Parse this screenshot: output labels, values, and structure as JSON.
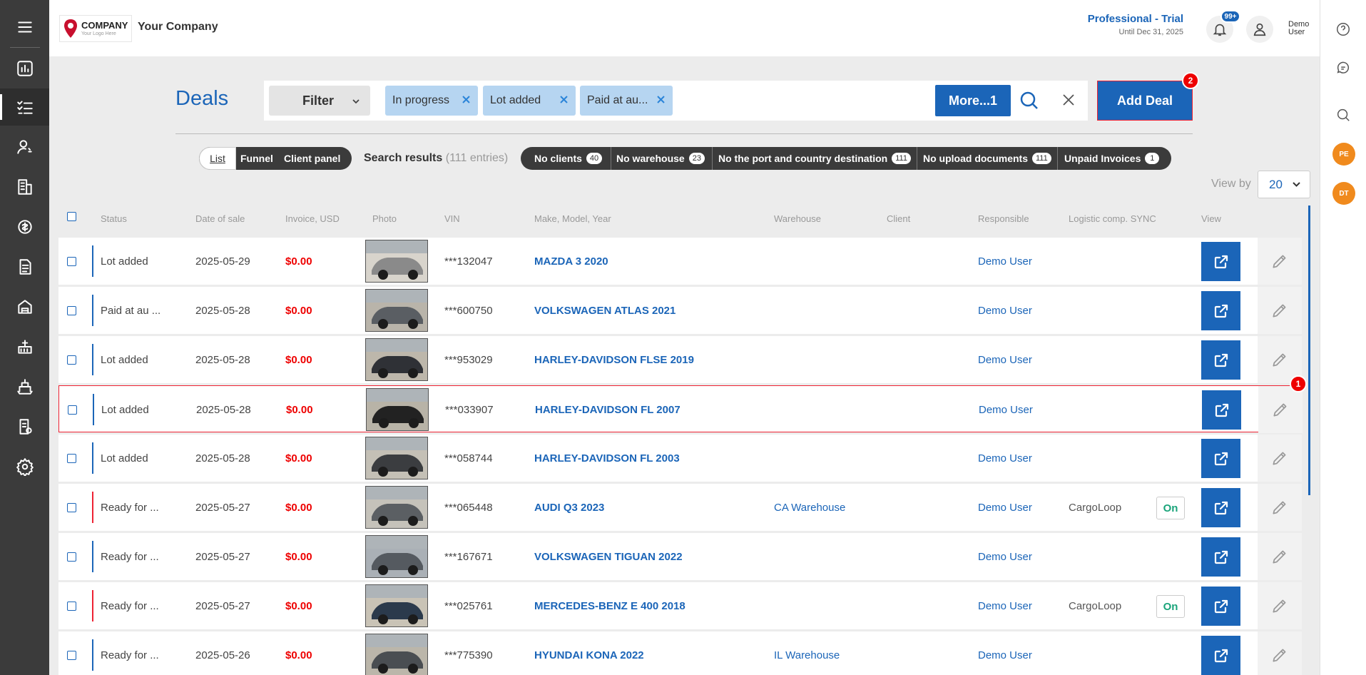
{
  "header": {
    "logo_main": "COMPANY",
    "logo_sub": "Your Logo Here",
    "company_name": "Your Company",
    "plan_title": "Professional - Trial",
    "plan_sub": "Until Dec 31, 2025",
    "notifications_badge": "99+",
    "user_name_line1": "Demo",
    "user_name_line2": "User"
  },
  "sidebar": {
    "items": [
      "menu-icon",
      "dashboard-icon",
      "deals-icon",
      "clients-icon",
      "company-icon",
      "finance-icon",
      "documents-icon",
      "warehouse-icon",
      "container-icon",
      "shipping-icon",
      "invoices-icon",
      "settings-icon"
    ]
  },
  "rightbar": {
    "avatars": [
      "PE",
      "DT"
    ]
  },
  "page": {
    "title": "Deals"
  },
  "filter": {
    "label": "Filter",
    "chips": [
      "In progress",
      "Lot added",
      "Paid at au..."
    ],
    "more_label": "More...1",
    "add_deal_label": "Add Deal",
    "add_deal_badge": "2"
  },
  "view_toggle": {
    "list": "List",
    "funnel": "Funnel",
    "client_panel": "Client panel"
  },
  "search_results": {
    "label": "Search results",
    "count": "(111 entries)"
  },
  "tags": [
    {
      "label": "No clients",
      "count": "40"
    },
    {
      "label": "No warehouse",
      "count": "23"
    },
    {
      "label": "No the port and country destination",
      "count": "111"
    },
    {
      "label": "No upload documents",
      "count": "111"
    },
    {
      "label": "Unpaid Invoices",
      "count": "1"
    }
  ],
  "view_by": {
    "label": "View by",
    "value": "20"
  },
  "table": {
    "columns": [
      "Status",
      "Date of sale",
      "Invoice, USD",
      "Photo",
      "VIN",
      "Make, Model, Year",
      "Warehouse",
      "Client",
      "Responsible",
      "Logistic comp. SYNC",
      "View"
    ],
    "rows": [
      {
        "status": "Lot added",
        "date": "2025-05-29",
        "invoice": "$0.00",
        "vin": "***132047",
        "make": "MAZDA 3 2020",
        "warehouse": "",
        "client": "",
        "responsible": "Demo User",
        "logistic": "",
        "sync": "",
        "bar": "#1b65b8"
      },
      {
        "status": "Paid at au ...",
        "date": "2025-05-28",
        "invoice": "$0.00",
        "vin": "***600750",
        "make": "VOLKSWAGEN ATLAS 2021",
        "warehouse": "",
        "client": "",
        "responsible": "Demo User",
        "logistic": "",
        "sync": "",
        "bar": "#1b65b8"
      },
      {
        "status": "Lot added",
        "date": "2025-05-28",
        "invoice": "$0.00",
        "vin": "***953029",
        "make": "HARLEY-DAVIDSON FLSE 2019",
        "warehouse": "",
        "client": "",
        "responsible": "Demo User",
        "logistic": "",
        "sync": "",
        "bar": "#1b65b8"
      },
      {
        "status": "Lot added",
        "date": "2025-05-28",
        "invoice": "$0.00",
        "vin": "***033907",
        "make": "HARLEY-DAVIDSON FL 2007",
        "warehouse": "",
        "client": "",
        "responsible": "Demo User",
        "logistic": "",
        "sync": "",
        "bar": "#1b65b8",
        "badge": "1"
      },
      {
        "status": "Lot added",
        "date": "2025-05-28",
        "invoice": "$0.00",
        "vin": "***058744",
        "make": "HARLEY-DAVIDSON FL 2003",
        "warehouse": "",
        "client": "",
        "responsible": "Demo User",
        "logistic": "",
        "sync": "",
        "bar": "#1b65b8"
      },
      {
        "status": "Ready for ...",
        "date": "2025-05-27",
        "invoice": "$0.00",
        "vin": "***065448",
        "make": "AUDI Q3 2023",
        "warehouse": "CA Warehouse",
        "client": "",
        "responsible": "Demo User",
        "logistic": "CargoLoop",
        "sync": "On",
        "bar": "#e23"
      },
      {
        "status": "Ready for ...",
        "date": "2025-05-27",
        "invoice": "$0.00",
        "vin": "***167671",
        "make": "VOLKSWAGEN TIGUAN 2022",
        "warehouse": "",
        "client": "",
        "responsible": "Demo User",
        "logistic": "",
        "sync": "",
        "bar": "#1b65b8"
      },
      {
        "status": "Ready for ...",
        "date": "2025-05-27",
        "invoice": "$0.00",
        "vin": "***025761",
        "make": "MERCEDES-BENZ E 400 2018",
        "warehouse": "",
        "client": "",
        "responsible": "Demo User",
        "logistic": "CargoLoop",
        "sync": "On",
        "bar": "#e23"
      },
      {
        "status": "Ready for ...",
        "date": "2025-05-26",
        "invoice": "$0.00",
        "vin": "***775390",
        "make": "HYUNDAI KONA 2022",
        "warehouse": "IL Warehouse",
        "client": "",
        "responsible": "Demo User",
        "logistic": "",
        "sync": "",
        "bar": "#1b65b8"
      }
    ]
  }
}
